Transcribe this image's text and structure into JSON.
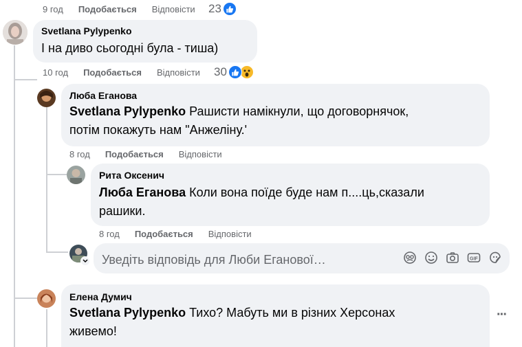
{
  "top_meta": {
    "time": "9 год",
    "like": "Подобається",
    "reply": "Відповісти",
    "count": "23"
  },
  "c1": {
    "author": "Svetlana Pylypenko",
    "text": "І на диво сьогодні була - тиша)",
    "meta": {
      "time": "10 год",
      "like": "Подобається",
      "reply": "Відповісти",
      "count": "30"
    }
  },
  "c2": {
    "author": "Люба Еганова",
    "mention": "Svetlana Pylypenko",
    "text_line1": " Рашисти намікнули, що договорнячок,",
    "text_line2": "потім покажуть нам \"Анжеліну.'",
    "meta": {
      "time": "8 год",
      "like": "Подобається",
      "reply": "Відповісти"
    }
  },
  "c3": {
    "author": "Рита Оксенич",
    "mention": "Люба Еганова",
    "text_line1": " Коли вона поїде буде нам п....ць,сказали",
    "text_line2": "рашики.",
    "meta": {
      "time": "8 год",
      "like": "Подобається",
      "reply": "Відповісти"
    }
  },
  "reply_input": {
    "placeholder": "Уведіть відповідь для Люби Еганової…",
    "tools": [
      "avatar-sticker-icon",
      "emoji-icon",
      "camera-icon",
      "gif-icon",
      "sticker-icon"
    ]
  },
  "c4": {
    "author": "Елена Думич",
    "mention": "Svetlana Pylypenko",
    "text_line1": " Тихо? Мабуть ми в різних Херсонах",
    "text_line2": "живемо!",
    "more": "···"
  },
  "colors": {
    "bubble": "#f0f2f5",
    "meta_text": "#65676b",
    "like_blue": "#1877f2",
    "wow_yellow": "#f7b928",
    "thread_line": "#ced0d4"
  }
}
